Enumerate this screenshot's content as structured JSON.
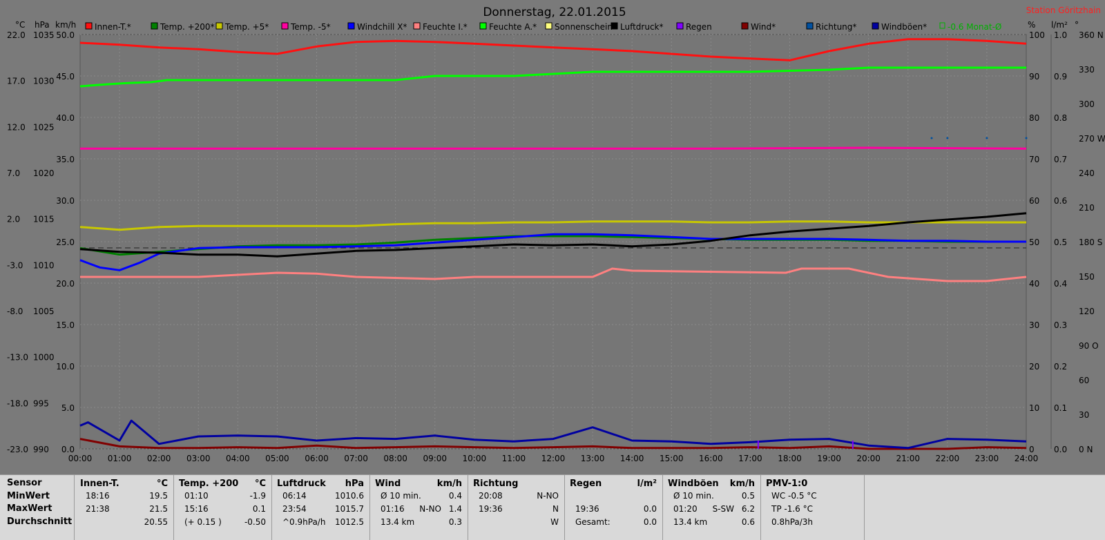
{
  "header": {
    "title": "Donnerstag, 22.01.2015",
    "station": "Station Göritzhain",
    "unit_labels_left": [
      "°C",
      "hPa",
      "km/h"
    ],
    "unit_labels_right": [
      "%",
      "l/m²",
      "°"
    ]
  },
  "legend": [
    {
      "label": "Innen-T.*",
      "color": "#ff1010"
    },
    {
      "label": "Temp. +200*",
      "color": "#008000"
    },
    {
      "label": "Temp. +5*",
      "color": "#c8c800"
    },
    {
      "label": "Temp. -5*",
      "color": "#ff00a0"
    },
    {
      "label": "Windchill X*",
      "color": "#0000ff"
    },
    {
      "label": "Feuchte I.*",
      "color": "#ff8080"
    },
    {
      "label": "Feuchte A.*",
      "color": "#00ff00"
    },
    {
      "label": "Sonnenschein",
      "color": "#ffff80"
    },
    {
      "label": "Luftdruck*",
      "color": "#000000"
    },
    {
      "label": "Regen",
      "color": "#8000ff"
    },
    {
      "label": "Wind*",
      "color": "#800000"
    },
    {
      "label": "Richtung*",
      "color": "#0050a0"
    },
    {
      "label": "Windböen*",
      "color": "#0000a0"
    }
  ],
  "legend_extra": {
    "label": "-0.6 Monat-Ø",
    "color": "#00b000"
  },
  "chart_data": {
    "type": "line",
    "title": "Donnerstag, 22.01.2015",
    "x": [
      "00:00",
      "01:00",
      "02:00",
      "03:00",
      "04:00",
      "05:00",
      "06:00",
      "07:00",
      "08:00",
      "09:00",
      "10:00",
      "11:00",
      "12:00",
      "13:00",
      "14:00",
      "15:00",
      "16:00",
      "17:00",
      "18:00",
      "19:00",
      "20:00",
      "21:00",
      "22:00",
      "23:00",
      "24:00"
    ],
    "xlim": [
      0,
      24
    ],
    "axes": {
      "celsius": {
        "ticks": [
          "22.0",
          "17.0",
          "12.0",
          "7.0",
          "2.0",
          "-3.0",
          "-8.0",
          "-13.0",
          "-18.0",
          "-23.0"
        ],
        "ylim": [
          -23,
          22
        ]
      },
      "hpa": {
        "ticks": [
          "1035",
          "1030",
          "1025",
          "1020",
          "1015",
          "1010",
          "1005",
          "1000",
          "995",
          "990"
        ],
        "ylim": [
          990,
          1035
        ]
      },
      "kmh": {
        "ticks": [
          "50.0",
          "45.0",
          "40.0",
          "35.0",
          "30.0",
          "25.0",
          "20.0",
          "15.0",
          "10.0",
          "5.0",
          "0.0"
        ],
        "ylim": [
          0,
          50
        ]
      },
      "percent": {
        "ticks": [
          "100",
          "90",
          "80",
          "70",
          "60",
          "50",
          "40",
          "30",
          "20",
          "10",
          "0"
        ],
        "ylim": [
          0,
          100
        ]
      },
      "rain": {
        "ticks": [
          "1.0",
          "0.9",
          "0.8",
          "0.7",
          "0.6",
          "0.5",
          "0.4",
          "0.3",
          "0.2",
          "0.1",
          "0.0"
        ],
        "ylim": [
          0,
          1
        ]
      },
      "direction": {
        "ticks": [
          "360 N",
          "330",
          "300",
          "270 W",
          "240",
          "210",
          "180 S",
          "150",
          "120",
          "90 O",
          "60",
          "30",
          "0 N"
        ],
        "ylim": [
          0,
          360
        ]
      }
    },
    "grid": true,
    "reference_line": {
      "axis": "percent",
      "value": 48.5
    },
    "series": [
      {
        "name": "Innen-T.*",
        "color": "#ff1010",
        "axis": "celsius",
        "x": [
          0,
          1,
          2,
          3,
          4,
          5,
          6,
          7,
          8,
          9,
          10,
          11,
          12,
          13,
          14,
          15,
          16,
          17,
          18,
          19,
          20,
          21,
          22,
          23,
          24
        ],
        "y": [
          21.1,
          20.9,
          20.6,
          20.4,
          20.1,
          19.9,
          20.7,
          21.2,
          21.3,
          21.2,
          21.0,
          20.8,
          20.6,
          20.4,
          20.2,
          19.9,
          19.6,
          19.4,
          19.2,
          20.2,
          21.0,
          21.5,
          21.5,
          21.3,
          21.0
        ]
      },
      {
        "name": "Temp. +200*",
        "color": "#008000",
        "axis": "celsius",
        "x": [
          0,
          1,
          2,
          3,
          4,
          5,
          6,
          7,
          8,
          9,
          10,
          11,
          12,
          13,
          14,
          15,
          16,
          17,
          18,
          19,
          20,
          21,
          22,
          23,
          24
        ],
        "y": [
          -1.2,
          -1.9,
          -1.6,
          -1.3,
          -1.0,
          -0.9,
          -0.9,
          -0.8,
          -0.6,
          -0.3,
          -0.1,
          0.1,
          0.1,
          0.1,
          0.0,
          -0.1,
          -0.2,
          -0.3,
          -0.3,
          -0.3,
          -0.4,
          -0.4,
          -0.5,
          -0.5,
          -0.5
        ]
      },
      {
        "name": "Temp. +5*",
        "color": "#c8c800",
        "axis": "celsius",
        "x": [
          0,
          1,
          2,
          3,
          4,
          5,
          6,
          7,
          8,
          9,
          10,
          11,
          12,
          13,
          14,
          15,
          16,
          17,
          18,
          19,
          20,
          21,
          22,
          23,
          24
        ],
        "y": [
          1.1,
          0.8,
          1.1,
          1.2,
          1.2,
          1.2,
          1.2,
          1.2,
          1.4,
          1.5,
          1.5,
          1.6,
          1.6,
          1.7,
          1.7,
          1.7,
          1.6,
          1.6,
          1.7,
          1.7,
          1.6,
          1.6,
          1.6,
          1.6,
          1.6
        ]
      },
      {
        "name": "Temp. -5*",
        "color": "#ff00a0",
        "axis": "celsius",
        "x": [
          0,
          4,
          8,
          12,
          16,
          20,
          24
        ],
        "y": [
          9.6,
          9.6,
          9.6,
          9.6,
          9.6,
          9.7,
          9.6
        ]
      },
      {
        "name": "Windchill X*",
        "color": "#0000ff",
        "axis": "celsius",
        "x": [
          0,
          0.5,
          1,
          1.5,
          2,
          3,
          4,
          5,
          6,
          7,
          8,
          9,
          10,
          11,
          12,
          13,
          14,
          15,
          16,
          17,
          18,
          19,
          20,
          21,
          22,
          23,
          24
        ],
        "y": [
          -2.5,
          -3.3,
          -3.6,
          -2.8,
          -1.8,
          -1.2,
          -1.1,
          -1.1,
          -1.1,
          -1.0,
          -0.9,
          -0.6,
          -0.3,
          0.0,
          0.3,
          0.3,
          0.2,
          0.0,
          -0.2,
          -0.2,
          -0.2,
          -0.2,
          -0.3,
          -0.4,
          -0.4,
          -0.5,
          -0.5
        ]
      },
      {
        "name": "Feuchte I.*",
        "color": "#ff8080",
        "axis": "percent",
        "x": [
          0,
          3,
          5,
          6,
          7,
          9,
          10,
          13,
          13.5,
          14,
          17.9,
          18.3,
          19.5,
          20.5,
          22,
          23,
          24
        ],
        "y": [
          41.5,
          41.5,
          42.5,
          42.3,
          41.5,
          41,
          41.5,
          41.5,
          43.5,
          43,
          42.5,
          43.5,
          43.5,
          41.5,
          40.5,
          40.5,
          41.5
        ]
      },
      {
        "name": "Feuchte A.*",
        "color": "#00ff00",
        "axis": "percent",
        "x": [
          0,
          0.7,
          1.2,
          1.8,
          2.2,
          4,
          6,
          8,
          9,
          11,
          12,
          13,
          15,
          17,
          19,
          20,
          22,
          24
        ],
        "y": [
          87.5,
          88,
          88.3,
          88.5,
          89,
          89,
          89,
          89,
          90,
          90,
          90.5,
          91,
          91,
          91,
          91.5,
          92,
          92,
          92
        ]
      },
      {
        "name": "Luftdruck*",
        "color": "#000000",
        "axis": "hpa",
        "x": [
          0,
          1,
          2,
          3,
          4,
          5,
          6,
          7,
          8,
          9,
          10,
          11,
          12,
          13,
          14,
          15,
          16,
          17,
          18,
          19,
          20,
          21,
          22,
          23,
          24
        ],
        "y": [
          1011.7,
          1011.4,
          1011.3,
          1011.1,
          1011.1,
          1010.9,
          1011.2,
          1011.5,
          1011.6,
          1011.8,
          1012.0,
          1012.2,
          1012.1,
          1012.2,
          1012.0,
          1012.2,
          1012.6,
          1013.2,
          1013.6,
          1013.9,
          1014.2,
          1014.6,
          1014.9,
          1015.2,
          1015.6
        ]
      },
      {
        "name": "Wind*",
        "color": "#800000",
        "axis": "kmh",
        "x": [
          0,
          1,
          2,
          3,
          4,
          5,
          6,
          7,
          8,
          9,
          10,
          11,
          12,
          13,
          14,
          15,
          16,
          17,
          18,
          19,
          20,
          21,
          22,
          23,
          24
        ],
        "y": [
          1.2,
          0.3,
          0.1,
          0.1,
          0.2,
          0.1,
          0.4,
          0.1,
          0.2,
          0.3,
          0.2,
          0.1,
          0.2,
          0.3,
          0.1,
          0.1,
          0.1,
          0.2,
          0.1,
          0.3,
          0.0,
          0.0,
          0.0,
          0.2,
          0.1
        ]
      },
      {
        "name": "Windböen*",
        "color": "#0000a0",
        "axis": "kmh",
        "x": [
          0,
          0.2,
          1,
          1.3,
          2,
          3,
          4,
          5,
          6,
          7,
          8,
          9,
          10,
          11,
          12,
          13,
          14,
          15,
          16,
          17,
          18,
          19,
          20,
          21,
          22,
          23,
          24
        ],
        "y": [
          2.8,
          3.2,
          1.0,
          3.4,
          0.6,
          1.5,
          1.6,
          1.5,
          1.0,
          1.3,
          1.2,
          1.6,
          1.1,
          0.9,
          1.2,
          2.6,
          1.0,
          0.9,
          0.6,
          0.8,
          1.1,
          1.2,
          0.4,
          0.1,
          1.2,
          1.1,
          0.9
        ]
      },
      {
        "name": "Regen",
        "color": "#8000ff",
        "axis": "rain",
        "x": [
          17.2,
          19.6
        ],
        "y": [
          0.02,
          0.02
        ]
      },
      {
        "name": "Richtung*",
        "color": "#0050a0",
        "axis": "direction",
        "type": "scatter",
        "x": [
          21.6,
          22,
          23,
          24
        ],
        "y": [
          270,
          270,
          270,
          270
        ]
      }
    ]
  },
  "stats": {
    "row_labels": [
      "Sensor",
      "MinWert",
      "MaxWert",
      "Durchschnitt"
    ],
    "groups": [
      {
        "title": "Innen-T.",
        "unit": "°C",
        "rows": [
          {
            "time": "18:16",
            "mid": "",
            "value": "19.5"
          },
          {
            "time": "21:38",
            "mid": "",
            "value": "21.5"
          },
          {
            "time": "",
            "mid": "",
            "value": "20.55"
          }
        ]
      },
      {
        "title": "Temp. +200",
        "unit": "°C",
        "rows": [
          {
            "time": "01:10",
            "mid": "",
            "value": "-1.9"
          },
          {
            "time": "15:16",
            "mid": "",
            "value": "0.1"
          },
          {
            "time": "(+ 0.15 )",
            "mid": "",
            "value": "-0.50"
          }
        ]
      },
      {
        "title": "Luftdruck",
        "unit": "hPa",
        "rows": [
          {
            "time": "06:14",
            "mid": "",
            "value": "1010.6"
          },
          {
            "time": "23:54",
            "mid": "",
            "value": "1015.7"
          },
          {
            "time": "^0.9hPa/h",
            "mid": "",
            "value": "1012.5"
          }
        ]
      },
      {
        "title": "Wind",
        "unit": "km/h",
        "rows": [
          {
            "time": "Ø 10 min.",
            "mid": "",
            "value": "0.4"
          },
          {
            "time": "01:16",
            "mid": "N-NO",
            "value": "1.4"
          },
          {
            "time": "13.4 km",
            "mid": "",
            "value": "0.3"
          }
        ]
      },
      {
        "title": "Richtung",
        "unit": "",
        "rows": [
          {
            "time": "20:08",
            "mid": "",
            "value": "N-NO"
          },
          {
            "time": "19:36",
            "mid": "",
            "value": "N"
          },
          {
            "time": "",
            "mid": "",
            "value": "W"
          }
        ]
      },
      {
        "title": "Regen",
        "unit": "l/m²",
        "rows": [
          {
            "time": "",
            "mid": "",
            "value": ""
          },
          {
            "time": "19:36",
            "mid": "",
            "value": "0.0"
          },
          {
            "time": "Gesamt:",
            "mid": "",
            "value": "0.0"
          }
        ]
      },
      {
        "title": "Windböen",
        "unit": "km/h",
        "rows": [
          {
            "time": "Ø 10 min.",
            "mid": "",
            "value": "0.5"
          },
          {
            "time": "01:20",
            "mid": "S-SW",
            "value": "6.2"
          },
          {
            "time": "13.4 km",
            "mid": "",
            "value": "0.6"
          }
        ]
      },
      {
        "title": "PMV-1:0",
        "unit": "",
        "rows": [
          {
            "time": "WC -0.5 °C",
            "mid": "",
            "value": ""
          },
          {
            "time": "TP -1.6 °C",
            "mid": "",
            "value": ""
          },
          {
            "time": "0.8hPa/3h",
            "mid": "",
            "value": ""
          }
        ]
      }
    ]
  }
}
